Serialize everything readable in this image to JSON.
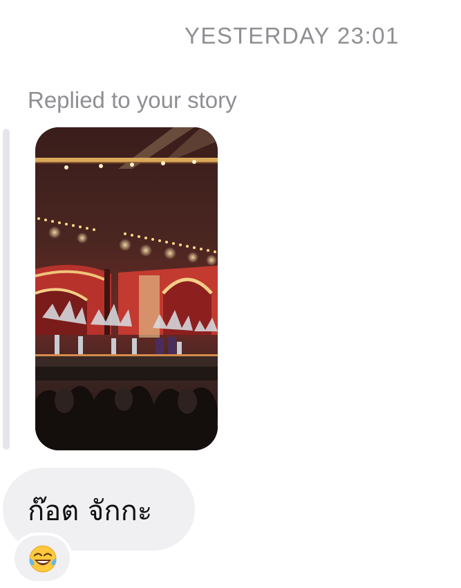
{
  "header": {
    "timestamp": "YESTERDAY 23:01"
  },
  "story_reply": {
    "label": "Replied to your story",
    "thumbnail": "concert-stage-photo"
  },
  "message": {
    "text": "ก๊อต จักกะ"
  },
  "reaction": {
    "emoji_name": "face-with-tears-of-joy-icon"
  },
  "colors": {
    "meta_text": "#8e8e93",
    "bubble": "#f0f0f3",
    "reply_bar": "#e4e6ea"
  }
}
